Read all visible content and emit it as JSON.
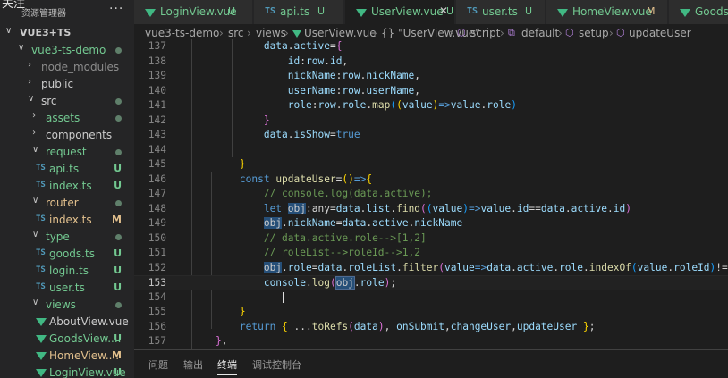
{
  "sidebar": {
    "follow_label": "关注",
    "title": "资源管理器",
    "more_label": "···",
    "root": "VUE3+TS",
    "items": [
      {
        "label": "vue3-ts-demo",
        "kind": "folder",
        "expanded": true,
        "indent": 1,
        "marker": "dot",
        "color": "green"
      },
      {
        "label": "node_modules",
        "kind": "folder",
        "expanded": false,
        "indent": 2,
        "marker": "",
        "color": "gray"
      },
      {
        "label": "public",
        "kind": "folder",
        "expanded": false,
        "indent": 2,
        "marker": "",
        "color": "plain"
      },
      {
        "label": "src",
        "kind": "folder",
        "expanded": true,
        "indent": 2,
        "marker": "dot",
        "color": "plain"
      },
      {
        "label": "assets",
        "kind": "folder",
        "expanded": false,
        "indent": 3,
        "marker": "dot",
        "color": "green"
      },
      {
        "label": "components",
        "kind": "folder",
        "expanded": false,
        "indent": 3,
        "marker": "",
        "color": "plain"
      },
      {
        "label": "request",
        "kind": "folder",
        "expanded": true,
        "indent": 3,
        "marker": "dot",
        "color": "green"
      },
      {
        "label": "api.ts",
        "kind": "ts",
        "indent": 4,
        "marker": "U",
        "color": "green"
      },
      {
        "label": "index.ts",
        "kind": "ts",
        "indent": 4,
        "marker": "U",
        "color": "green"
      },
      {
        "label": "router",
        "kind": "folder",
        "expanded": true,
        "indent": 3,
        "marker": "dot",
        "color": "yellow"
      },
      {
        "label": "index.ts",
        "kind": "ts",
        "indent": 4,
        "marker": "M",
        "color": "yellow"
      },
      {
        "label": "type",
        "kind": "folder",
        "expanded": true,
        "indent": 3,
        "marker": "dot",
        "color": "green"
      },
      {
        "label": "goods.ts",
        "kind": "ts",
        "indent": 4,
        "marker": "U",
        "color": "green"
      },
      {
        "label": "login.ts",
        "kind": "ts",
        "indent": 4,
        "marker": "U",
        "color": "green"
      },
      {
        "label": "user.ts",
        "kind": "ts",
        "indent": 4,
        "marker": "U",
        "color": "green"
      },
      {
        "label": "views",
        "kind": "folder",
        "expanded": true,
        "indent": 3,
        "marker": "dot",
        "color": "green"
      },
      {
        "label": "AboutView.vue",
        "kind": "vue",
        "indent": 4,
        "marker": "",
        "color": "plain"
      },
      {
        "label": "GoodsView....",
        "kind": "vue",
        "indent": 4,
        "marker": "U",
        "color": "green"
      },
      {
        "label": "HomeView....",
        "kind": "vue",
        "indent": 4,
        "marker": "M",
        "color": "yellow"
      },
      {
        "label": "LoginView.vue",
        "kind": "vue",
        "indent": 4,
        "marker": "U",
        "color": "green"
      }
    ]
  },
  "tabs": [
    {
      "name": "LoginView.vue",
      "kind": "vue",
      "badge": "U",
      "active": false
    },
    {
      "name": "api.ts",
      "kind": "ts",
      "badge": "U",
      "active": false
    },
    {
      "name": "UserView.vue",
      "kind": "vue",
      "badge": "U",
      "active": true
    },
    {
      "name": "user.ts",
      "kind": "ts",
      "badge": "U",
      "active": false
    },
    {
      "name": "HomeView.vue",
      "kind": "vue",
      "badge": "M",
      "active": false
    },
    {
      "name": "GoodsVi",
      "kind": "vue",
      "badge": "",
      "active": false
    }
  ],
  "breadcrumb": {
    "parts": [
      "vue3-ts-demo",
      "src",
      "views",
      "UserView.vue",
      "{} \"UserView.vue\"",
      "script",
      "default",
      "setup",
      "updateUser"
    ]
  },
  "editor": {
    "current_line": "153",
    "lines": [
      {
        "n": "137",
        "tokens": [
          [
            "",
            "            "
          ],
          [
            "p",
            "data"
          ],
          [
            "o",
            "."
          ],
          [
            "p",
            "active"
          ],
          [
            "o",
            "="
          ],
          [
            "b2",
            "{"
          ]
        ]
      },
      {
        "n": "138",
        "tokens": [
          [
            "",
            "                "
          ],
          [
            "p",
            "id"
          ],
          [
            "o",
            ":"
          ],
          [
            "p",
            "row"
          ],
          [
            "o",
            "."
          ],
          [
            "p",
            "id"
          ],
          [
            "o",
            ","
          ]
        ]
      },
      {
        "n": "139",
        "tokens": [
          [
            "",
            "                "
          ],
          [
            "p",
            "nickName"
          ],
          [
            "o",
            ":"
          ],
          [
            "p",
            "row"
          ],
          [
            "o",
            "."
          ],
          [
            "p",
            "nickName"
          ],
          [
            "o",
            ","
          ]
        ]
      },
      {
        "n": "140",
        "tokens": [
          [
            "",
            "                "
          ],
          [
            "p",
            "userName"
          ],
          [
            "o",
            ":"
          ],
          [
            "p",
            "row"
          ],
          [
            "o",
            "."
          ],
          [
            "p",
            "userName"
          ],
          [
            "o",
            ","
          ]
        ]
      },
      {
        "n": "141",
        "tokens": [
          [
            "",
            "                "
          ],
          [
            "p",
            "role"
          ],
          [
            "o",
            ":"
          ],
          [
            "p",
            "row"
          ],
          [
            "o",
            "."
          ],
          [
            "p",
            "role"
          ],
          [
            "o",
            "."
          ],
          [
            "f",
            "map"
          ],
          [
            "b3",
            "("
          ],
          [
            "b1",
            "("
          ],
          [
            "p",
            "value"
          ],
          [
            "b1",
            ")"
          ],
          [
            "k",
            "=>"
          ],
          [
            "p",
            "value"
          ],
          [
            "o",
            "."
          ],
          [
            "p",
            "role"
          ],
          [
            "b3",
            ")"
          ]
        ]
      },
      {
        "n": "142",
        "tokens": [
          [
            "",
            "            "
          ],
          [
            "b2",
            "}"
          ]
        ]
      },
      {
        "n": "143",
        "tokens": [
          [
            "",
            "            "
          ],
          [
            "p",
            "data"
          ],
          [
            "o",
            "."
          ],
          [
            "p",
            "isShow"
          ],
          [
            "o",
            "="
          ],
          [
            "k",
            "true"
          ]
        ]
      },
      {
        "n": "144",
        "tokens": []
      },
      {
        "n": "145",
        "tokens": [
          [
            "",
            "        "
          ],
          [
            "b1",
            "}"
          ]
        ]
      },
      {
        "n": "146",
        "tokens": [
          [
            "",
            "        "
          ],
          [
            "k",
            "const "
          ],
          [
            "f",
            "updateUser"
          ],
          [
            "o",
            "="
          ],
          [
            "b1",
            "()"
          ],
          [
            "k",
            "=>"
          ],
          [
            "b1",
            "{"
          ]
        ]
      },
      {
        "n": "147",
        "tokens": [
          [
            "",
            "            "
          ],
          [
            "c",
            "// console.log(data.active);"
          ]
        ]
      },
      {
        "n": "148",
        "tokens": [
          [
            "",
            "            "
          ],
          [
            "k",
            "let "
          ],
          [
            "hl",
            "obj"
          ],
          [
            "o",
            ":any="
          ],
          [
            "p",
            "data"
          ],
          [
            "o",
            "."
          ],
          [
            "p",
            "list"
          ],
          [
            "o",
            "."
          ],
          [
            "f",
            "find"
          ],
          [
            "b2",
            "("
          ],
          [
            "b3",
            "("
          ],
          [
            "p",
            "value"
          ],
          [
            "b3",
            ")"
          ],
          [
            "k",
            "=>"
          ],
          [
            "p",
            "value"
          ],
          [
            "o",
            "."
          ],
          [
            "p",
            "id"
          ],
          [
            "o",
            "=="
          ],
          [
            "p",
            "data"
          ],
          [
            "o",
            "."
          ],
          [
            "p",
            "active"
          ],
          [
            "o",
            "."
          ],
          [
            "p",
            "id"
          ],
          [
            "b2",
            ")"
          ]
        ]
      },
      {
        "n": "149",
        "tokens": [
          [
            "",
            "            "
          ],
          [
            "hl",
            "obj"
          ],
          [
            "o",
            "."
          ],
          [
            "p",
            "nickName"
          ],
          [
            "o",
            "="
          ],
          [
            "p",
            "data"
          ],
          [
            "o",
            "."
          ],
          [
            "p",
            "active"
          ],
          [
            "o",
            "."
          ],
          [
            "p",
            "nickName"
          ]
        ]
      },
      {
        "n": "150",
        "tokens": [
          [
            "",
            "            "
          ],
          [
            "c",
            "// data.active.role-->[1,2]"
          ]
        ]
      },
      {
        "n": "151",
        "tokens": [
          [
            "",
            "            "
          ],
          [
            "c",
            "// roleList-->roleId-->1,2"
          ]
        ]
      },
      {
        "n": "152",
        "tokens": [
          [
            "",
            "            "
          ],
          [
            "hl",
            "obj"
          ],
          [
            "o",
            "."
          ],
          [
            "p",
            "role"
          ],
          [
            "o",
            "="
          ],
          [
            "p",
            "data"
          ],
          [
            "o",
            "."
          ],
          [
            "p",
            "roleList"
          ],
          [
            "o",
            "."
          ],
          [
            "f",
            "filter"
          ],
          [
            "b2",
            "("
          ],
          [
            "p",
            "value"
          ],
          [
            "k",
            "=>"
          ],
          [
            "p",
            "data"
          ],
          [
            "o",
            "."
          ],
          [
            "p",
            "active"
          ],
          [
            "o",
            "."
          ],
          [
            "p",
            "role"
          ],
          [
            "o",
            "."
          ],
          [
            "f",
            "indexOf"
          ],
          [
            "b3",
            "("
          ],
          [
            "p",
            "value"
          ],
          [
            "o",
            "."
          ],
          [
            "p",
            "roleId"
          ],
          [
            "b3",
            ")"
          ],
          [
            "o",
            "!==-1"
          ],
          [
            "b2",
            ")"
          ]
        ]
      },
      {
        "n": "153",
        "tokens": [
          [
            "",
            "            "
          ],
          [
            "p",
            "console"
          ],
          [
            "o",
            "."
          ],
          [
            "f",
            "log"
          ],
          [
            "b2",
            "("
          ],
          [
            "sel",
            "obj"
          ],
          [
            "o",
            "."
          ],
          [
            "p",
            "role"
          ],
          [
            "b2",
            ")"
          ],
          [
            "o",
            ";"
          ]
        ]
      },
      {
        "n": "154",
        "tokens": []
      },
      {
        "n": "155",
        "tokens": [
          [
            "",
            "        "
          ],
          [
            "b1",
            "}"
          ]
        ]
      },
      {
        "n": "156",
        "tokens": [
          [
            "",
            "        "
          ],
          [
            "k",
            "return "
          ],
          [
            "b1",
            "{ "
          ],
          [
            "o",
            "..."
          ],
          [
            "f",
            "toRefs"
          ],
          [
            "b2",
            "("
          ],
          [
            "p",
            "data"
          ],
          [
            "b2",
            ")"
          ],
          [
            "o",
            ", "
          ],
          [
            "p",
            "onSubmit"
          ],
          [
            "o",
            ","
          ],
          [
            "p",
            "changeUser"
          ],
          [
            "o",
            ","
          ],
          [
            "p",
            "updateUser"
          ],
          [
            "b1",
            " }"
          ],
          [
            "o",
            ";"
          ]
        ]
      },
      {
        "n": "157",
        "tokens": [
          [
            "",
            "    "
          ],
          [
            "b2",
            "}"
          ],
          [
            "o",
            ","
          ]
        ]
      }
    ]
  },
  "panel": {
    "tabs": [
      "问题",
      "输出",
      "终端",
      "调试控制台"
    ],
    "active": "终端"
  }
}
